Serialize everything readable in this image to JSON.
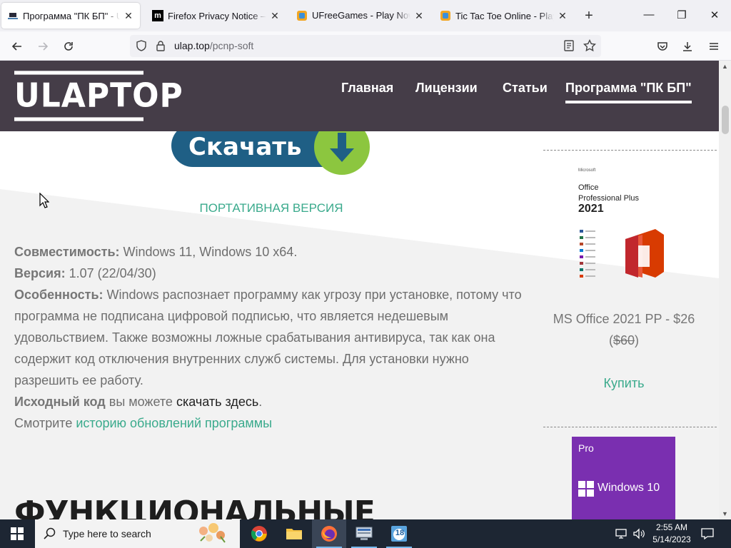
{
  "browser": {
    "tabs": [
      {
        "title": "Программа \"ПК БП\" - ULaptop",
        "favicon": "ulaptop-favicon",
        "active": true
      },
      {
        "title": "Firefox Privacy Notice — Mozilla",
        "favicon": "mozilla-favicon",
        "active": false
      },
      {
        "title": "UFreeGames - Play Now 🎮",
        "favicon": "ufreegames-favicon",
        "active": false
      },
      {
        "title": "Tic Tac Toe Online - Play Now",
        "favicon": "tictactoe-favicon",
        "active": false
      }
    ],
    "url_host": "ulap.top",
    "url_path": "/pcnp-soft"
  },
  "site": {
    "logo": "ULAPTOP",
    "nav": [
      {
        "label": "Главная",
        "active": false
      },
      {
        "label": "Лицензии",
        "active": false
      },
      {
        "label": "Статьи",
        "active": false
      },
      {
        "label": "Программа \"ПК БП\"",
        "active": true
      }
    ]
  },
  "main": {
    "download_label": "Скачать",
    "portable_label": "ПОРТАТИВНАЯ ВЕРСИЯ",
    "compat_label": "Совместимость:",
    "compat_value": "Windows 11, Windows 10 x64.",
    "version_label": "Версия:",
    "version_value": "1.07 (22/04/30)",
    "feature_label": "Особенность:",
    "feature_value": "Windows распознает программу как угрозу при установке, потому что программа не подписана цифровой подписью, что является недешевым удовольствием. Также возможны ложные срабатывания антивируса, так как она содержит код отключения внутренних служб системы. Для установки нужно разрешить ее работу.",
    "source_label": "Исходный код",
    "source_text": "вы можете",
    "source_link": "скачать здесь",
    "source_end": ".",
    "history_text": "Смотрите",
    "history_link": "историю обновлений программы",
    "heading_partial": "ФУНКЦИОНАЛЬНЫЕ"
  },
  "sidebar": {
    "office": {
      "img_brand": "Microsoft",
      "img_title": "Office",
      "img_subtitle": "Professional Plus",
      "img_year": "2021",
      "title": "MS Office 2021 PP - $26",
      "old_price": "$60",
      "buy_label": "Купить"
    },
    "windows": {
      "edition": "Pro",
      "name": "Windows 10"
    }
  },
  "taskbar": {
    "search_placeholder": "Type here to search",
    "apps": [
      "chrome-icon",
      "file-explorer-icon",
      "firefox-icon",
      "network-app-icon",
      "calendar-app-icon"
    ],
    "calendar_badge": "18",
    "time": "2:55 AM",
    "date": "5/14/2023"
  },
  "colors": {
    "header_bg": "#453d48",
    "accent_green": "#3aaa8c",
    "taskbar_bg": "#1d2633",
    "windows_purple": "#7a2fb0"
  }
}
